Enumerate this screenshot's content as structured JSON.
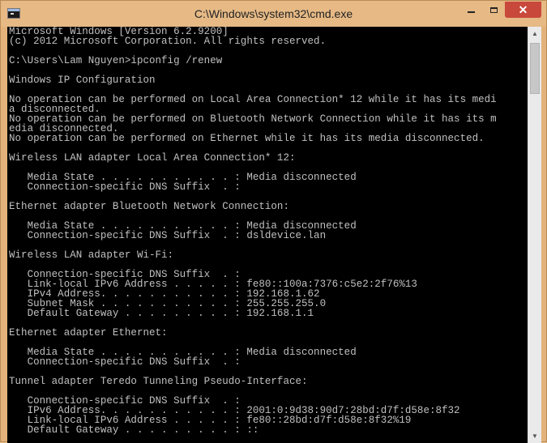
{
  "window": {
    "title": "C:\\Windows\\system32\\cmd.exe",
    "icon": "cmd-console-icon",
    "close_symbol": "✕",
    "minimize_icon": "minimize-icon",
    "maximize_icon": "maximize-icon"
  },
  "console": {
    "lines": [
      "Microsoft Windows [Version 6.2.9200]",
      "(c) 2012 Microsoft Corporation. All rights reserved.",
      "",
      "C:\\Users\\Lam Nguyen>ipconfig /renew",
      "",
      "Windows IP Configuration",
      "",
      "No operation can be performed on Local Area Connection* 12 while it has its medi",
      "a disconnected.",
      "No operation can be performed on Bluetooth Network Connection while it has its m",
      "edia disconnected.",
      "No operation can be performed on Ethernet while it has its media disconnected.",
      "",
      "Wireless LAN adapter Local Area Connection* 12:",
      "",
      "   Media State . . . . . . . . . . . : Media disconnected",
      "   Connection-specific DNS Suffix  . :",
      "",
      "Ethernet adapter Bluetooth Network Connection:",
      "",
      "   Media State . . . . . . . . . . . : Media disconnected",
      "   Connection-specific DNS Suffix  . : dsldevice.lan",
      "",
      "Wireless LAN adapter Wi-Fi:",
      "",
      "   Connection-specific DNS Suffix  . :",
      "   Link-local IPv6 Address . . . . . : fe80::100a:7376:c5e2:2f76%13",
      "   IPv4 Address. . . . . . . . . . . : 192.168.1.62",
      "   Subnet Mask . . . . . . . . . . . : 255.255.255.0",
      "   Default Gateway . . . . . . . . . : 192.168.1.1",
      "",
      "Ethernet adapter Ethernet:",
      "",
      "   Media State . . . . . . . . . . . : Media disconnected",
      "   Connection-specific DNS Suffix  . :",
      "",
      "Tunnel adapter Teredo Tunneling Pseudo-Interface:",
      "",
      "   Connection-specific DNS Suffix  . :",
      "   IPv6 Address. . . . . . . . . . . : 2001:0:9d38:90d7:28bd:d7f:d58e:8f32",
      "   Link-local IPv6 Address . . . . . : fe80::28bd:d7f:d58e:8f32%19",
      "   Default Gateway . . . . . . . . . : ::"
    ]
  },
  "scrollbar": {
    "up_arrow": "▲",
    "down_arrow": "▼"
  },
  "colors": {
    "titlebar": "#e6b985",
    "console_bg": "#000000",
    "console_text": "#c0c0c0",
    "close_button": "#c9483c"
  }
}
